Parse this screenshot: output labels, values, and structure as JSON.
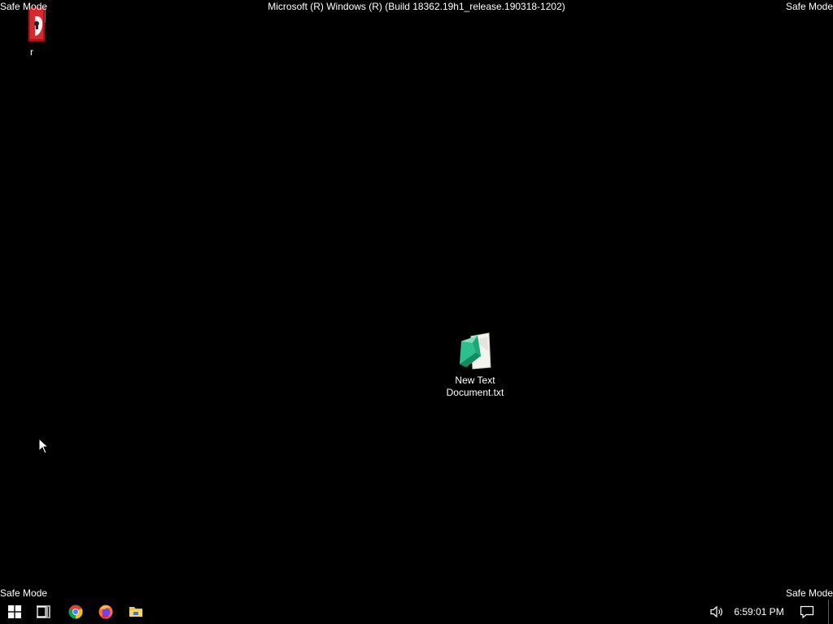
{
  "overlay": {
    "safe_mode_top_left": "Safe Mode",
    "safe_mode_top_right": "Safe Mode",
    "safe_mode_bottom_left": "Safe Mode",
    "safe_mode_bottom_right": "Safe Mode",
    "build_text": "Microsoft (R) Windows (R) (Build 18362.19h1_release.190318-1202)"
  },
  "desktop": {
    "background_color": "#000000",
    "icons": [
      {
        "label": "r",
        "icon": "red-shortcut-icon"
      },
      {
        "label": "New Text Document.txt",
        "icon": "text-document-icon"
      }
    ]
  },
  "taskbar": {
    "buttons": [
      {
        "name": "Start",
        "icon": "windows-logo-icon"
      },
      {
        "name": "Task View",
        "icon": "task-view-icon"
      },
      {
        "name": "Google Chrome",
        "icon": "chrome-icon"
      },
      {
        "name": "Firefox",
        "icon": "firefox-icon"
      },
      {
        "name": "File Explorer",
        "icon": "folder-icon"
      }
    ],
    "tray": {
      "volume_icon": "speaker-icon",
      "clock": "6:59:01 PM",
      "notification_icon": "action-center-icon"
    }
  }
}
